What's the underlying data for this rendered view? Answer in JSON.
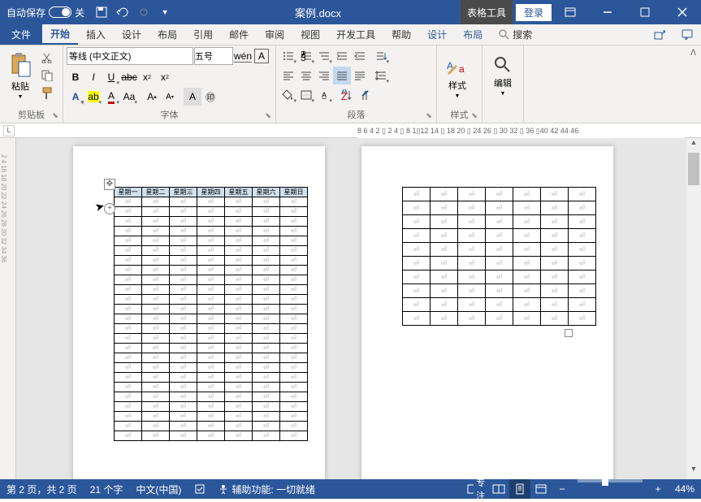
{
  "titlebar": {
    "autosave_label": "自动保存",
    "autosave_state": "关",
    "doc_title": "案例.docx",
    "table_tools": "表格工具",
    "login": "登录"
  },
  "tabs": {
    "file": "文件",
    "home": "开始",
    "insert": "插入",
    "design": "设计",
    "layout": "布局",
    "references": "引用",
    "mailings": "邮件",
    "review": "审阅",
    "view": "视图",
    "dev": "开发工具",
    "help": "帮助",
    "ctx_design": "设计",
    "ctx_layout": "布局",
    "search": "搜索"
  },
  "ribbon": {
    "clipboard": {
      "label": "剪贴板",
      "paste": "粘贴"
    },
    "font": {
      "label": "字体",
      "family": "等线 (中文正文)",
      "size": "五号"
    },
    "paragraph": {
      "label": "段落"
    },
    "styles": {
      "label": "样式",
      "btn": "样式"
    },
    "editing": {
      "label": "",
      "btn": "编辑"
    }
  },
  "ruler": {
    "corner": "L",
    "marks": "8  6  4  2 ▯  2  4 ▯  8 1▯12 14 ▯ 18 20 ▯ 24 26 ▯ 30 32 ▯ 36 ▯40 42 44 46"
  },
  "vruler": "2  4            16 18 20 22 24 26 28 30 32 34 36",
  "table1": {
    "headers": [
      "星期一",
      "星期二",
      "星期三",
      "星期四",
      "星期五",
      "星期六",
      "星期日"
    ],
    "rows": 25,
    "cols": 7
  },
  "table2": {
    "rows": 10,
    "cols": 7
  },
  "statusbar": {
    "page": "第 2 页，共 2 页",
    "words": "21 个字",
    "lang": "中文(中国)",
    "a11y": "辅助功能: 一切就绪",
    "focus": "专注",
    "zoom": "44%"
  }
}
